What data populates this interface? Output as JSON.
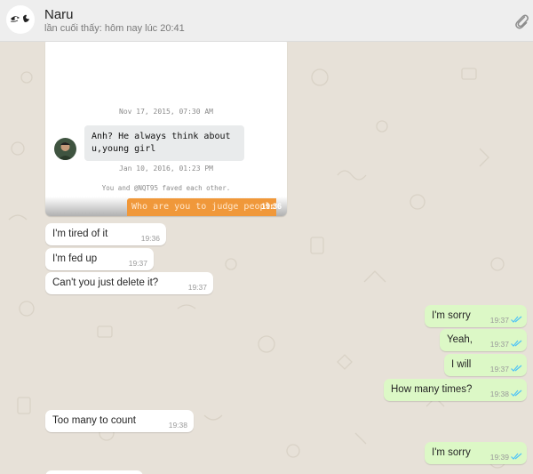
{
  "header": {
    "contact_name": "Naru",
    "last_seen": "lần cuối thấy: hôm nay lúc 20:41",
    "attach_icon": "paperclip-icon",
    "avatar_icon": "anime-eye-avatar"
  },
  "image_message": {
    "date_1": "Nov 17, 2015, 07:30 AM",
    "quoted_text": "Anh? He always think about u,young girl",
    "date_2": "Jan 10, 2016, 01:23 PM",
    "note": "You and @NQT95 faved each other.",
    "reply_preview": "Who are you to judge people",
    "time": "19:36"
  },
  "messages": [
    {
      "dir": "in",
      "text": "I'm tired of it",
      "time": "19:36"
    },
    {
      "dir": "in",
      "text": "I'm fed up",
      "time": "19:37"
    },
    {
      "dir": "in",
      "text": "Can't you just delete it?",
      "time": "19:37"
    },
    {
      "dir": "out",
      "text": "I'm sorry",
      "time": "19:37",
      "status": "read"
    },
    {
      "dir": "out",
      "text": "Yeah,",
      "time": "19:37",
      "status": "read"
    },
    {
      "dir": "out",
      "text": "I will",
      "time": "19:37",
      "status": "read"
    },
    {
      "dir": "out",
      "text": "How many times?",
      "time": "19:38",
      "status": "read"
    },
    {
      "dir": "in",
      "text": "Too many to count",
      "time": "19:38"
    },
    {
      "dir": "out",
      "text": "I'm sorry",
      "time": "19:39",
      "status": "read"
    }
  ],
  "colors": {
    "chat_background": "#e7e1d8",
    "incoming_bubble": "#ffffff",
    "outgoing_bubble": "#dcf8c6",
    "read_ticks": "#4fc3f7",
    "header_background": "#eeeeee"
  }
}
